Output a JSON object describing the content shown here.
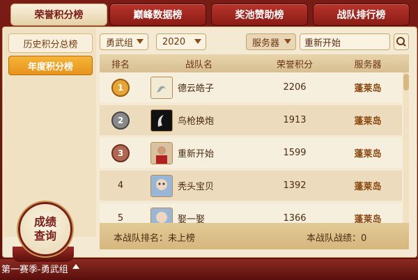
{
  "tabs": [
    {
      "label": "荣誉积分榜",
      "active": true
    },
    {
      "label": "巅峰数据榜",
      "active": false
    },
    {
      "label": "奖池赞助榜",
      "active": false
    },
    {
      "label": "战队排行榜",
      "active": false
    }
  ],
  "sidebar": {
    "items": [
      {
        "label": "历史积分总榜"
      },
      {
        "label": "年度积分榜",
        "active": true
      }
    ],
    "query_button": {
      "line1": "成绩",
      "line2": "查询"
    }
  },
  "filters": {
    "group": "勇武组",
    "year": "2020",
    "server_label": "服务器",
    "search_value": "重新开始"
  },
  "table": {
    "columns": [
      "排名",
      "战队名",
      "荣誉积分",
      "服务器"
    ],
    "rows": [
      {
        "rank": "1",
        "name": "德云皓子",
        "score": "2206",
        "server": "蓬莱岛"
      },
      {
        "rank": "2",
        "name": "鸟枪换炮",
        "score": "1913",
        "server": "蓬莱岛"
      },
      {
        "rank": "3",
        "name": "重新开始",
        "score": "1599",
        "server": "蓬莱岛"
      },
      {
        "rank": "4",
        "name": "秃头宝贝",
        "score": "1392",
        "server": "蓬莱岛"
      },
      {
        "rank": "5",
        "name": "娶一娶",
        "score": "1366",
        "server": "蓬莱岛"
      }
    ]
  },
  "footer": {
    "my_rank": "本战队排名：未上榜",
    "my_result": "本战队战绩：0"
  },
  "bottom": {
    "season_label": "第一赛季-勇武组"
  }
}
